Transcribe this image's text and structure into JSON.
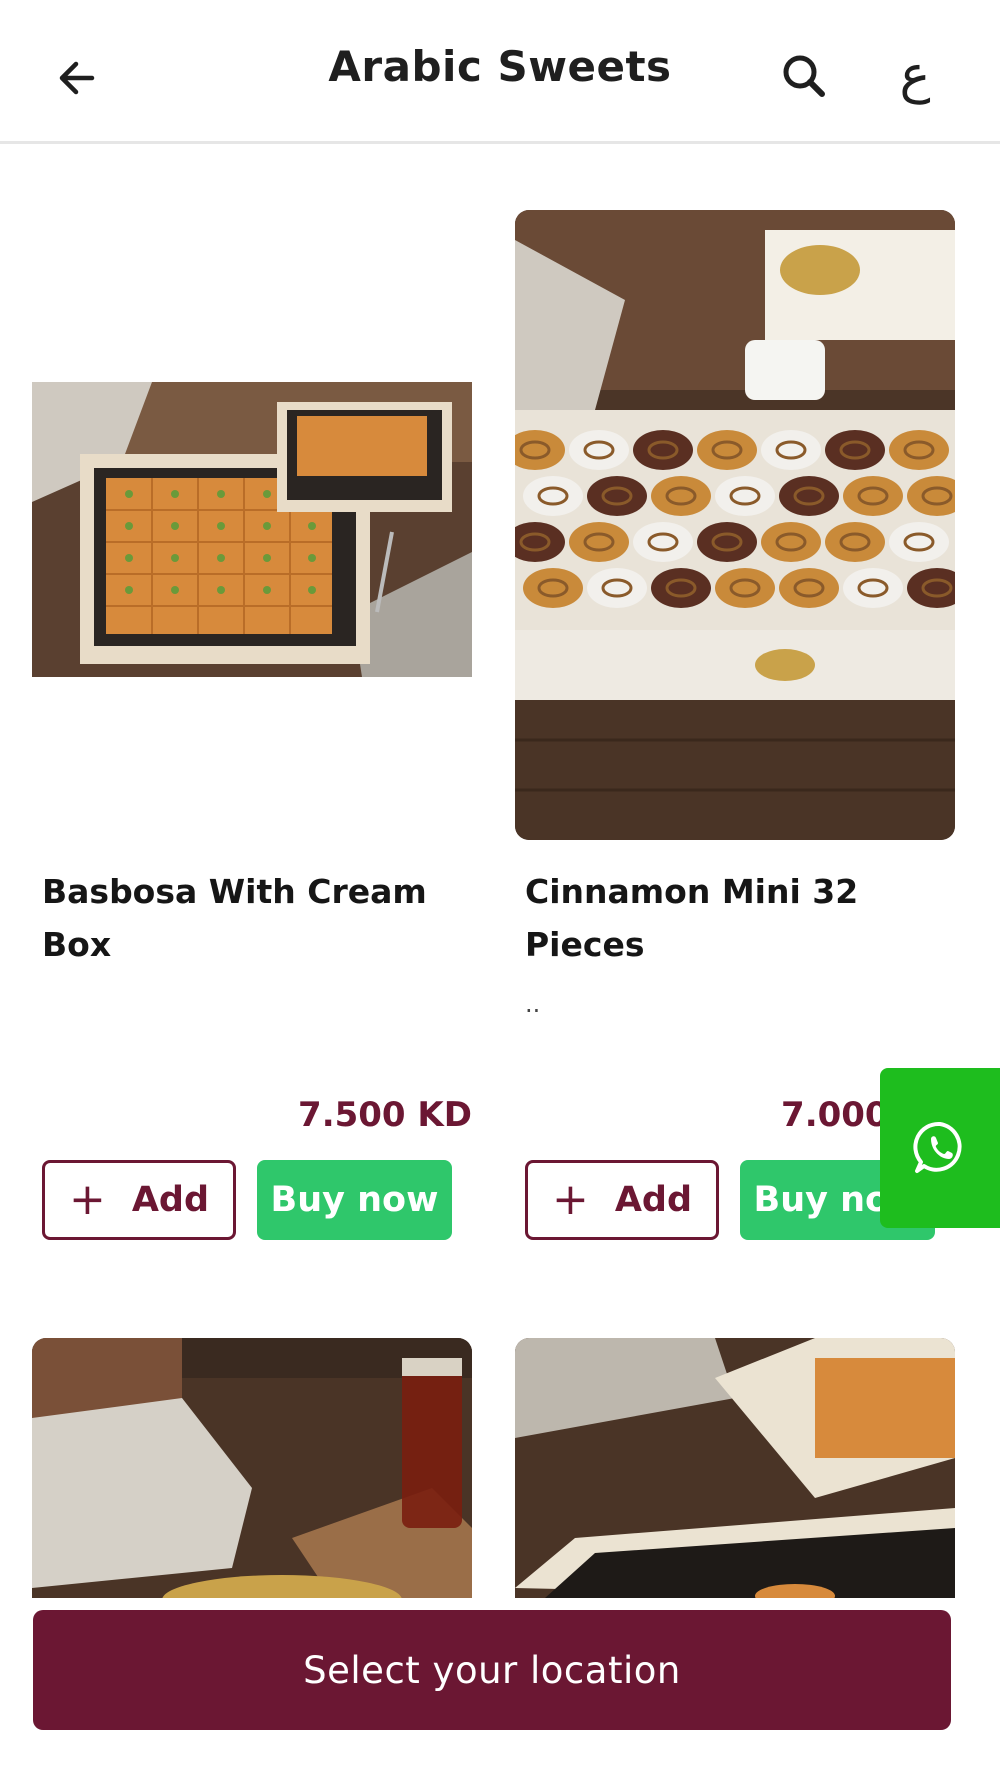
{
  "header": {
    "title": "Arabic Sweets",
    "language_toggle": "ع",
    "icons": [
      "back-arrow-icon",
      "search-icon"
    ]
  },
  "products": [
    {
      "name": "Basbosa With Cream Box",
      "description": "",
      "price": "7.500 KD",
      "add_label": "Add",
      "buy_label": "Buy now",
      "image": "photo of basbosa squares in a cream box on a wooden table"
    },
    {
      "name": "Cinnamon Mini 32 Pieces",
      "description": "..",
      "price": "7.000 KD",
      "add_label": "Add",
      "buy_label": "Buy now",
      "image": "photo of glazed mini cinnamon rolls in a KARAM gift tray"
    },
    {
      "name": "",
      "image": "photo of sweets with a glass of tea on a wooden table (partially visible)"
    },
    {
      "name": "",
      "image": "photo of a sweets box on a wooden table (partially visible)"
    }
  ],
  "floating": {
    "whatsapp_icon": "whatsapp-icon"
  },
  "footer": {
    "location_label": "Select your location"
  },
  "colors": {
    "brand": "#6b1733",
    "buy": "#2fc76b",
    "whatsapp": "#1ebd1e"
  }
}
